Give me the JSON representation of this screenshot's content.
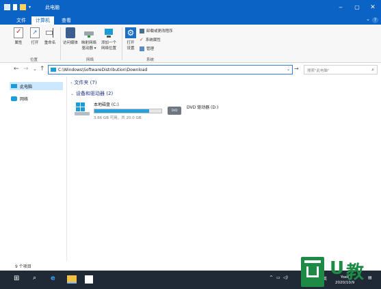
{
  "window": {
    "title": "此电脑",
    "min_btn": "‒",
    "max_btn": "▢",
    "close_btn": "✕"
  },
  "ribbon_tabs": [
    "文件",
    "计算机",
    "查看"
  ],
  "ribbon": {
    "group_location": {
      "label": "位置",
      "buttons": [
        "属性",
        "打开",
        "重命名"
      ]
    },
    "group_network": {
      "label": "网络",
      "buttons": [
        "访问媒体",
        "映射网络\n驱动器 ▾",
        "添加一个\n网络位置"
      ]
    },
    "group_system": {
      "label": "系统",
      "big_button": "打开\n设置",
      "items": [
        "卸载或更改程序",
        "系统属性",
        "管理"
      ]
    }
  },
  "nav": {
    "back": "←",
    "forward": "→",
    "recent": "⌄",
    "up": "↑",
    "address": "C:\\Windows\\SoftwareDistribution\\Download",
    "go": "→",
    "search_placeholder": "搜索\"此电脑\""
  },
  "sidebar": {
    "items": [
      "此电脑",
      "网络"
    ]
  },
  "sections": {
    "folders": "文件夹 (7)",
    "drives": "设备和驱动器 (2)"
  },
  "drives": [
    {
      "name": "本地磁盘 (C:)",
      "free": "3.66 GB 可用，共 20.0 GB",
      "used_fraction": 0.82
    },
    {
      "name": "DVD 驱动器 (D:)"
    }
  ],
  "status": {
    "count": "9 个项目"
  },
  "taskbar": {
    "clock_time": "Yoek",
    "clock_date": "2020/10/9"
  },
  "watermark": {
    "text_u": "U",
    "text_cn": "教"
  },
  "colors": {
    "titlebar": "#0b63c6",
    "taskbar": "#202a36",
    "drive_fill": "#26a0da",
    "watermark": "#1d8a45"
  }
}
